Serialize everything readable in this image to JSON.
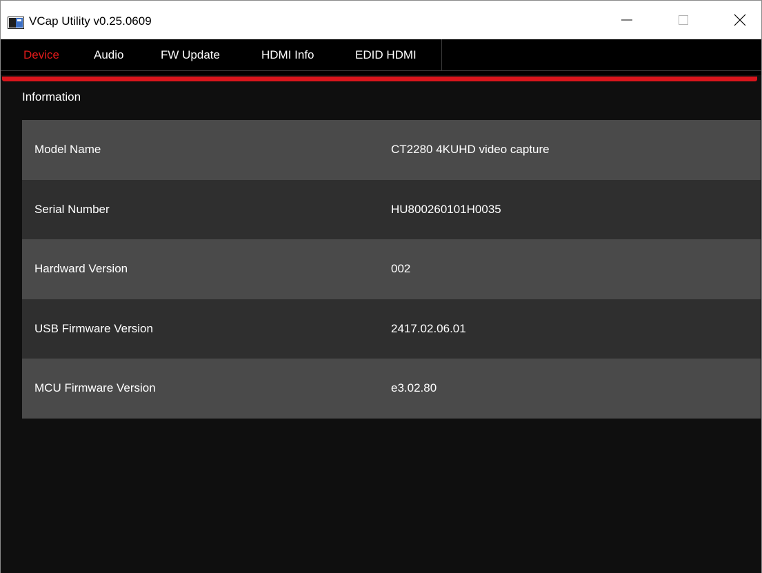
{
  "window": {
    "title": "VCap Utility  v0.25.0609",
    "icon": "app-window-icon"
  },
  "tabs": [
    {
      "label": "Device",
      "active": true
    },
    {
      "label": "Audio",
      "active": false
    },
    {
      "label": "FW Update",
      "active": false
    },
    {
      "label": "HDMI Info",
      "active": false
    },
    {
      "label": "EDID HDMI",
      "active": false
    }
  ],
  "content": {
    "section_title": "Information",
    "rows": [
      {
        "label": "Model Name",
        "value": "CT2280 4KUHD video capture"
      },
      {
        "label": "Serial Number",
        "value": "HU800260101H0035"
      },
      {
        "label": "Hardward Version",
        "value": "002"
      },
      {
        "label": "USB Firmware Version",
        "value": "2417.02.06.01"
      },
      {
        "label": "MCU Firmware Version",
        "value": "e3.02.80"
      }
    ]
  },
  "colors": {
    "accent": "#d8151c",
    "active_tab": "#e21a1a",
    "background": "#0f0f0f",
    "row_light": "#4a4a4a",
    "row_dark": "#2f2f2f"
  }
}
